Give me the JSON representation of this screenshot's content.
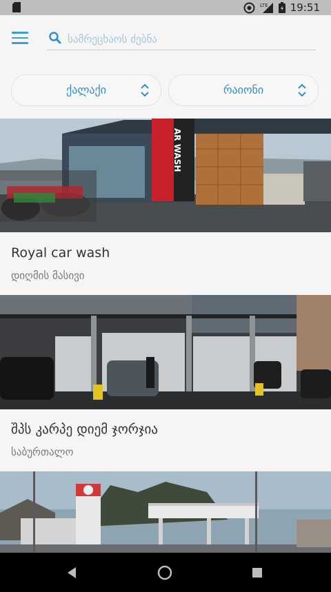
{
  "status_bar": {
    "time": "19:51",
    "network": "LTE",
    "icons": [
      "sim-icon",
      "data-saver-icon",
      "signal-icon",
      "battery-icon"
    ]
  },
  "header": {
    "search": {
      "placeholder": "სამრეცხაოს ძებნა",
      "value": ""
    },
    "city_select": {
      "label": "ქალაქი"
    },
    "district_select": {
      "label": "რაიონი"
    }
  },
  "listings": [
    {
      "title": "Royal car wash",
      "district": "დიღმის მასივი",
      "sign_text": "AR WASH"
    },
    {
      "title": "შპს კარპე დიემ ჯორჯია",
      "district": "საბურთალო"
    },
    {
      "title": "",
      "district": ""
    }
  ],
  "colors": {
    "accent": "#3a9bd5",
    "background": "#f5f5f5",
    "status_bar": "#bdbdbd",
    "nav_bar": "#000000"
  },
  "nav_bar": {
    "buttons": [
      "back-icon",
      "home-icon",
      "recents-icon"
    ]
  }
}
